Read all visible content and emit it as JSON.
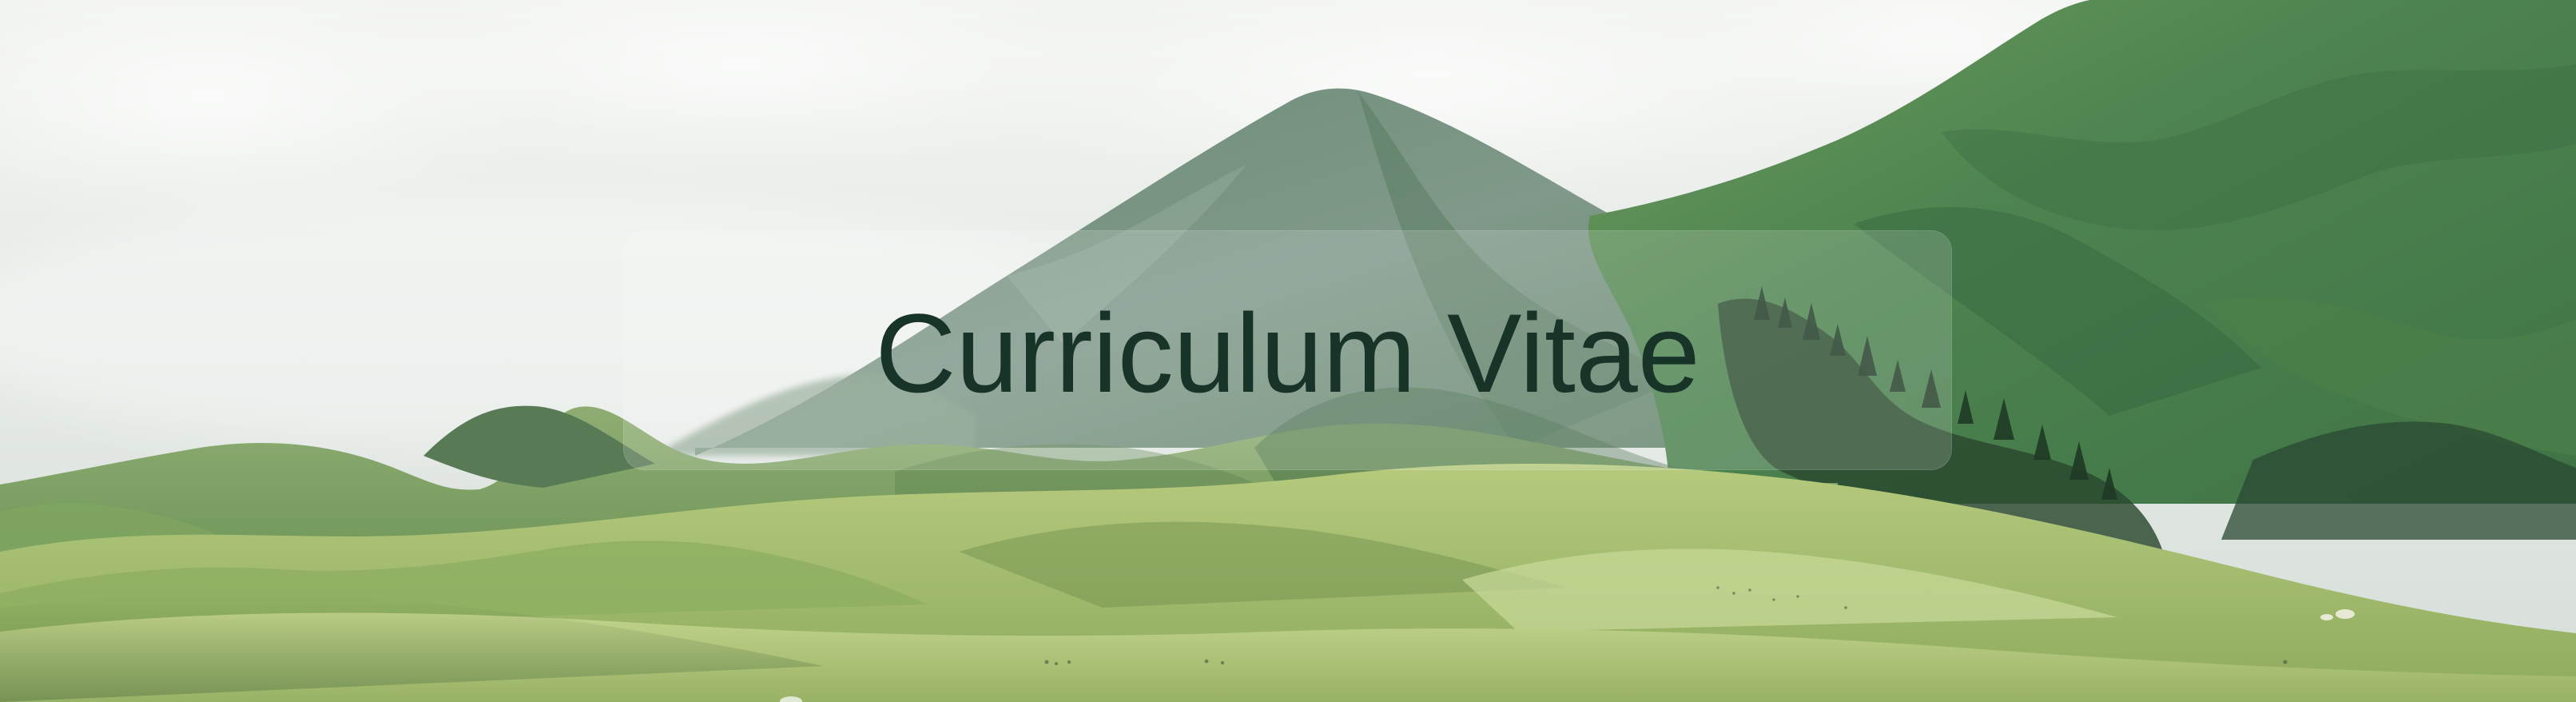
{
  "hero": {
    "title": "Curriculum Vitae",
    "title_color": "#183328"
  },
  "background": {
    "subject": "green mountain valley under cloudy sky",
    "sky_color": "#eef1ee",
    "mountain_color": "#4f8752",
    "meadow_color": "#9db768"
  }
}
